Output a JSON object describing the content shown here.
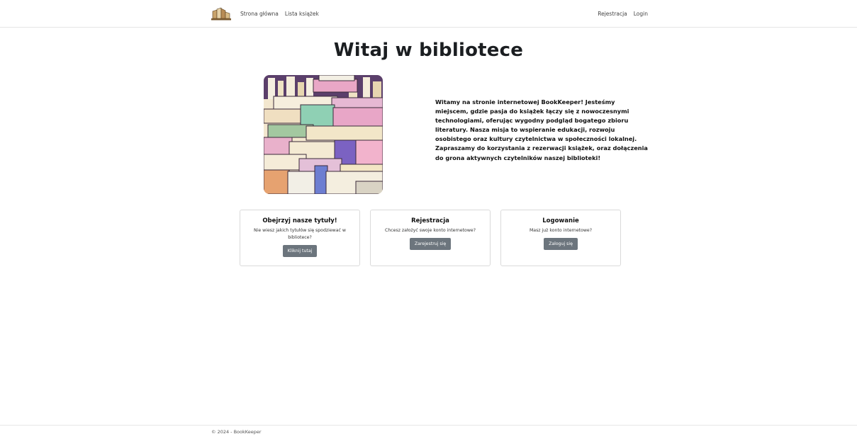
{
  "nav": {
    "logo_icon": "books-logo-icon",
    "links_left": [
      "Strona główna",
      "Lista książek"
    ],
    "links_right": [
      "Rejestracja",
      "Login"
    ]
  },
  "hero": {
    "title": "Witaj w bibliotece",
    "image_icon": "stacked-books-illustration",
    "intro": "Witamy na stronie internetowej BookKeeper! Jesteśmy miejscem, gdzie pasja do książek łączy się z nowoczesnymi technologiami, oferując wygodny podgląd bogatego zbioru literatury. Nasza misja to wspieranie edukacji, rozwoju osobistego oraz kultury czytelnictwa w społeczności lokalnej. Zapraszamy do korzystania z rezerwacji książek, oraz dołączenia do grona aktywnych czytelników naszej biblioteki!"
  },
  "cards": [
    {
      "title": "Obejrzyj nasze tytuły!",
      "text": "Nie wiesz jakich tytułów się spodziewać w bibliotece?",
      "button": "Kliknij tutaj"
    },
    {
      "title": "Rejestracja",
      "text": "Chcesz założyć swoje konto internetowe?",
      "button": "Zarejestruj się"
    },
    {
      "title": "Logowanie",
      "text": "Masz już konto internetowe?",
      "button": "Zaloguj się"
    }
  ],
  "footer": {
    "text": "© 2024 - BookKeeper"
  },
  "colors": {
    "button_bg": "#6c757d",
    "title": "#1b1e21",
    "border": "#dadada"
  }
}
